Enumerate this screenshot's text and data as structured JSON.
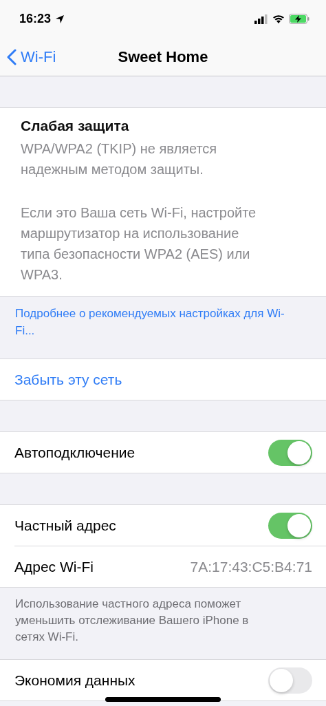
{
  "status_bar": {
    "time": "16:23"
  },
  "nav": {
    "back": "Wi-Fi",
    "title": "Sweet Home"
  },
  "warning": {
    "title": "Слабая защита",
    "paragraphs": [
      "WPA/WPA2 (TKIP) не является надежным методом защиты.",
      "Если это Ваша сеть Wi-Fi, настройте маршрутизатор на использование типа безопасности WPA2 (AES) или WPA3."
    ]
  },
  "warning_link": "Подробнее о рекомендуемых настройках для Wi-Fi...",
  "groups": [
    {
      "rows": [
        {
          "kind": "action",
          "label": "Забыть эту сеть"
        }
      ]
    },
    {
      "rows": [
        {
          "kind": "toggle",
          "label": "Автоподключение",
          "on": true
        }
      ]
    },
    {
      "rows": [
        {
          "kind": "toggle",
          "label": "Частный адрес",
          "on": true
        },
        {
          "kind": "value",
          "label": "Адрес Wi-Fi",
          "value": "7A:17:43:C5:B4:71"
        }
      ],
      "footer": "Использование частного адреса поможет уменьшить отслеживание Вашего iPhone в сетях Wi-Fi."
    },
    {
      "rows": [
        {
          "kind": "toggle",
          "label": "Экономия данных",
          "on": false
        }
      ]
    }
  ]
}
